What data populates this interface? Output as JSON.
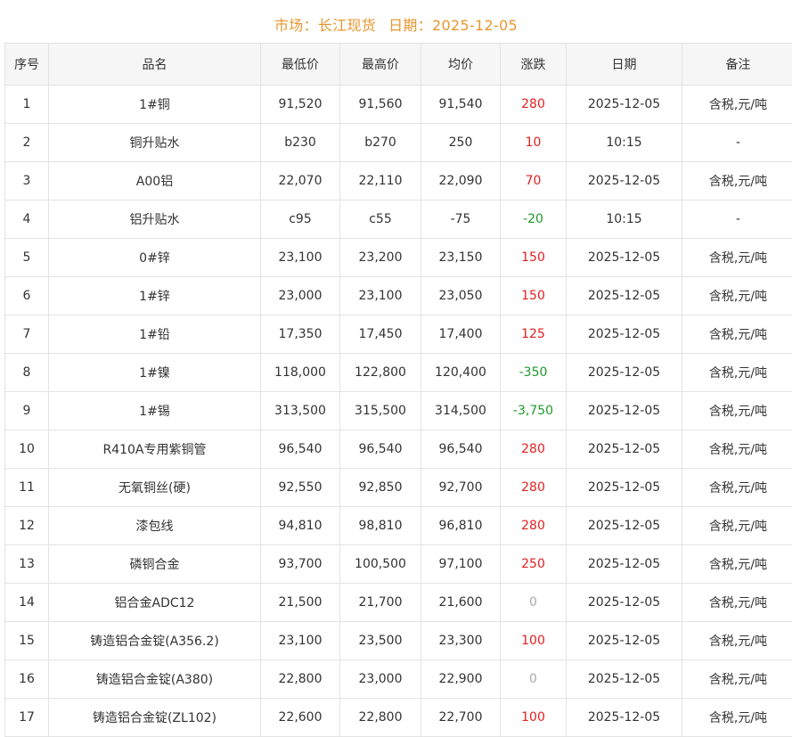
{
  "header": {
    "market_label": "市场：",
    "market_value": "长江现货",
    "date_label": "日期：",
    "date_value": "2025-12-05"
  },
  "table": {
    "columns": [
      "序号",
      "品名",
      "最低价",
      "最高价",
      "均价",
      "涨跌",
      "日期",
      "备注"
    ],
    "rows": [
      {
        "no": "1",
        "name": "1#铜",
        "low": "91,520",
        "high": "91,560",
        "avg": "91,540",
        "change": "280",
        "trend": "up",
        "date": "2025-12-05",
        "note": "含税,元/吨"
      },
      {
        "no": "2",
        "name": "铜升贴水",
        "low": "b230",
        "high": "b270",
        "avg": "250",
        "change": "10",
        "trend": "up",
        "date": "10:15",
        "note": "-"
      },
      {
        "no": "3",
        "name": "A00铝",
        "low": "22,070",
        "high": "22,110",
        "avg": "22,090",
        "change": "70",
        "trend": "up",
        "date": "2025-12-05",
        "note": "含税,元/吨"
      },
      {
        "no": "4",
        "name": "铝升贴水",
        "low": "c95",
        "high": "c55",
        "avg": "-75",
        "change": "-20",
        "trend": "down",
        "date": "10:15",
        "note": "-"
      },
      {
        "no": "5",
        "name": "0#锌",
        "low": "23,100",
        "high": "23,200",
        "avg": "23,150",
        "change": "150",
        "trend": "up",
        "date": "2025-12-05",
        "note": "含税,元/吨"
      },
      {
        "no": "6",
        "name": "1#锌",
        "low": "23,000",
        "high": "23,100",
        "avg": "23,050",
        "change": "150",
        "trend": "up",
        "date": "2025-12-05",
        "note": "含税,元/吨"
      },
      {
        "no": "7",
        "name": "1#铅",
        "low": "17,350",
        "high": "17,450",
        "avg": "17,400",
        "change": "125",
        "trend": "up",
        "date": "2025-12-05",
        "note": "含税,元/吨"
      },
      {
        "no": "8",
        "name": "1#镍",
        "low": "118,000",
        "high": "122,800",
        "avg": "120,400",
        "change": "-350",
        "trend": "down",
        "date": "2025-12-05",
        "note": "含税,元/吨"
      },
      {
        "no": "9",
        "name": "1#锡",
        "low": "313,500",
        "high": "315,500",
        "avg": "314,500",
        "change": "-3,750",
        "trend": "down",
        "date": "2025-12-05",
        "note": "含税,元/吨"
      },
      {
        "no": "10",
        "name": "R410A专用紫铜管",
        "low": "96,540",
        "high": "96,540",
        "avg": "96,540",
        "change": "280",
        "trend": "up",
        "date": "2025-12-05",
        "note": "含税,元/吨"
      },
      {
        "no": "11",
        "name": "无氧铜丝(硬)",
        "low": "92,550",
        "high": "92,850",
        "avg": "92,700",
        "change": "280",
        "trend": "up",
        "date": "2025-12-05",
        "note": "含税,元/吨"
      },
      {
        "no": "12",
        "name": "漆包线",
        "low": "94,810",
        "high": "98,810",
        "avg": "96,810",
        "change": "280",
        "trend": "up",
        "date": "2025-12-05",
        "note": "含税,元/吨"
      },
      {
        "no": "13",
        "name": "磷铜合金",
        "low": "93,700",
        "high": "100,500",
        "avg": "97,100",
        "change": "250",
        "trend": "up",
        "date": "2025-12-05",
        "note": "含税,元/吨"
      },
      {
        "no": "14",
        "name": "铝合金ADC12",
        "low": "21,500",
        "high": "21,700",
        "avg": "21,600",
        "change": "0",
        "trend": "flat",
        "date": "2025-12-05",
        "note": "含税,元/吨"
      },
      {
        "no": "15",
        "name": "铸造铝合金锭(A356.2)",
        "low": "23,100",
        "high": "23,500",
        "avg": "23,300",
        "change": "100",
        "trend": "up",
        "date": "2025-12-05",
        "note": "含税,元/吨"
      },
      {
        "no": "16",
        "name": "铸造铝合金锭(A380)",
        "low": "22,800",
        "high": "23,000",
        "avg": "22,900",
        "change": "0",
        "trend": "flat",
        "date": "2025-12-05",
        "note": "含税,元/吨"
      },
      {
        "no": "17",
        "name": "铸造铝合金锭(ZL102)",
        "low": "22,600",
        "high": "22,800",
        "avg": "22,700",
        "change": "100",
        "trend": "up",
        "date": "2025-12-05",
        "note": "含税,元/吨"
      }
    ]
  },
  "colors": {
    "title": "#e8962e",
    "up": "#e02020",
    "down": "#1f9a2c",
    "flat": "#aaaaaa",
    "header_bg": "#f6f6f6",
    "border": "#e3e3e3"
  }
}
